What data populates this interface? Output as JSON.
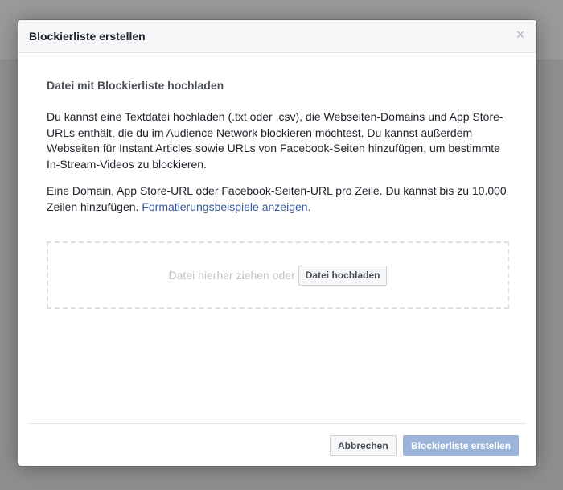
{
  "dialog": {
    "title": "Blockierliste erstellen",
    "close_glyph": "×"
  },
  "content": {
    "section_title": "Datei mit Blockierliste hochladen",
    "paragraph1": "Du kannst eine Textdatei hochladen (.txt oder .csv), die Webseiten-Domains und App Store-URLs enthält, die du im Audience Network blockieren möchtest. Du kannst außerdem Webseiten für Instant Articles sowie URLs von Facebook-Seiten hinzufügen, um bestimmte In-Stream-Videos zu blockieren.",
    "paragraph2": "Eine Domain, App Store-URL oder Facebook-Seiten-URL pro Zeile. Du kannst bis zu 10.000 Zeilen hinzufügen.",
    "example_link": "Formatierungsbeispiele anzeigen."
  },
  "dropzone": {
    "hint": "Datei hierher ziehen oder",
    "upload_button": "Datei hochladen"
  },
  "footer": {
    "cancel_label": "Abbrechen",
    "create_label": "Blockierliste erstellen"
  },
  "colors": {
    "link": "#365899",
    "primary_disabled": "#9cb4d8"
  }
}
